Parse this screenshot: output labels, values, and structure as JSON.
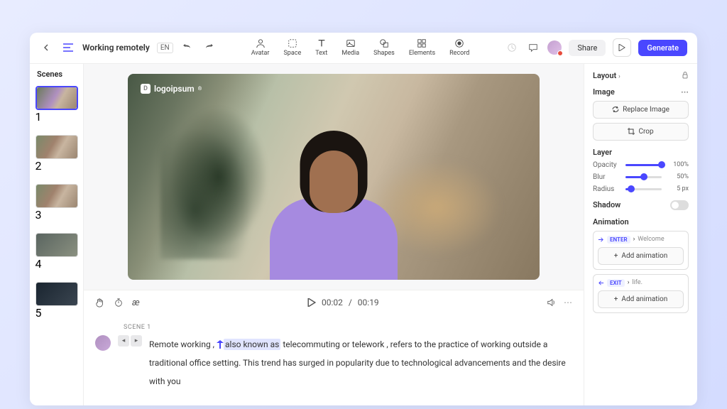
{
  "header": {
    "title": "Working remotely",
    "lang": "EN"
  },
  "tools": {
    "avatar": "Avatar",
    "space": "Space",
    "text": "Text",
    "media": "Media",
    "shapes": "Shapes",
    "elements": "Elements",
    "record": "Record"
  },
  "actions": {
    "share": "Share",
    "generate": "Generate"
  },
  "scenes": {
    "title": "Scenes",
    "items": [
      "1",
      "2",
      "3",
      "4",
      "5"
    ]
  },
  "canvas": {
    "logo": "logoipsum"
  },
  "player": {
    "current": "00:02",
    "total": "00:19"
  },
  "script": {
    "scene_label": "SCENE 1",
    "text_pre": "Remote working , ",
    "text_highlight": "also known as",
    "text_post": " telecommuting or telework , refers to the practice of working outside a traditional office setting. This trend has surged in popularity due to technological advancements and the desire with you"
  },
  "panel": {
    "layout": "Layout",
    "image": {
      "title": "Image",
      "replace": "Replace Image",
      "crop": "Crop"
    },
    "layer": {
      "title": "Layer",
      "opacity_label": "Opacity",
      "opacity_val": "100%",
      "blur_label": "Blur",
      "blur_val": "50%",
      "radius_label": "Radius",
      "radius_val": "5 px"
    },
    "shadow": "Shadow",
    "animation": {
      "title": "Animation",
      "enter": "ENTER",
      "enter_word": "Welcome",
      "exit": "EXIT",
      "exit_word": "life.",
      "add": "Add animation"
    }
  }
}
